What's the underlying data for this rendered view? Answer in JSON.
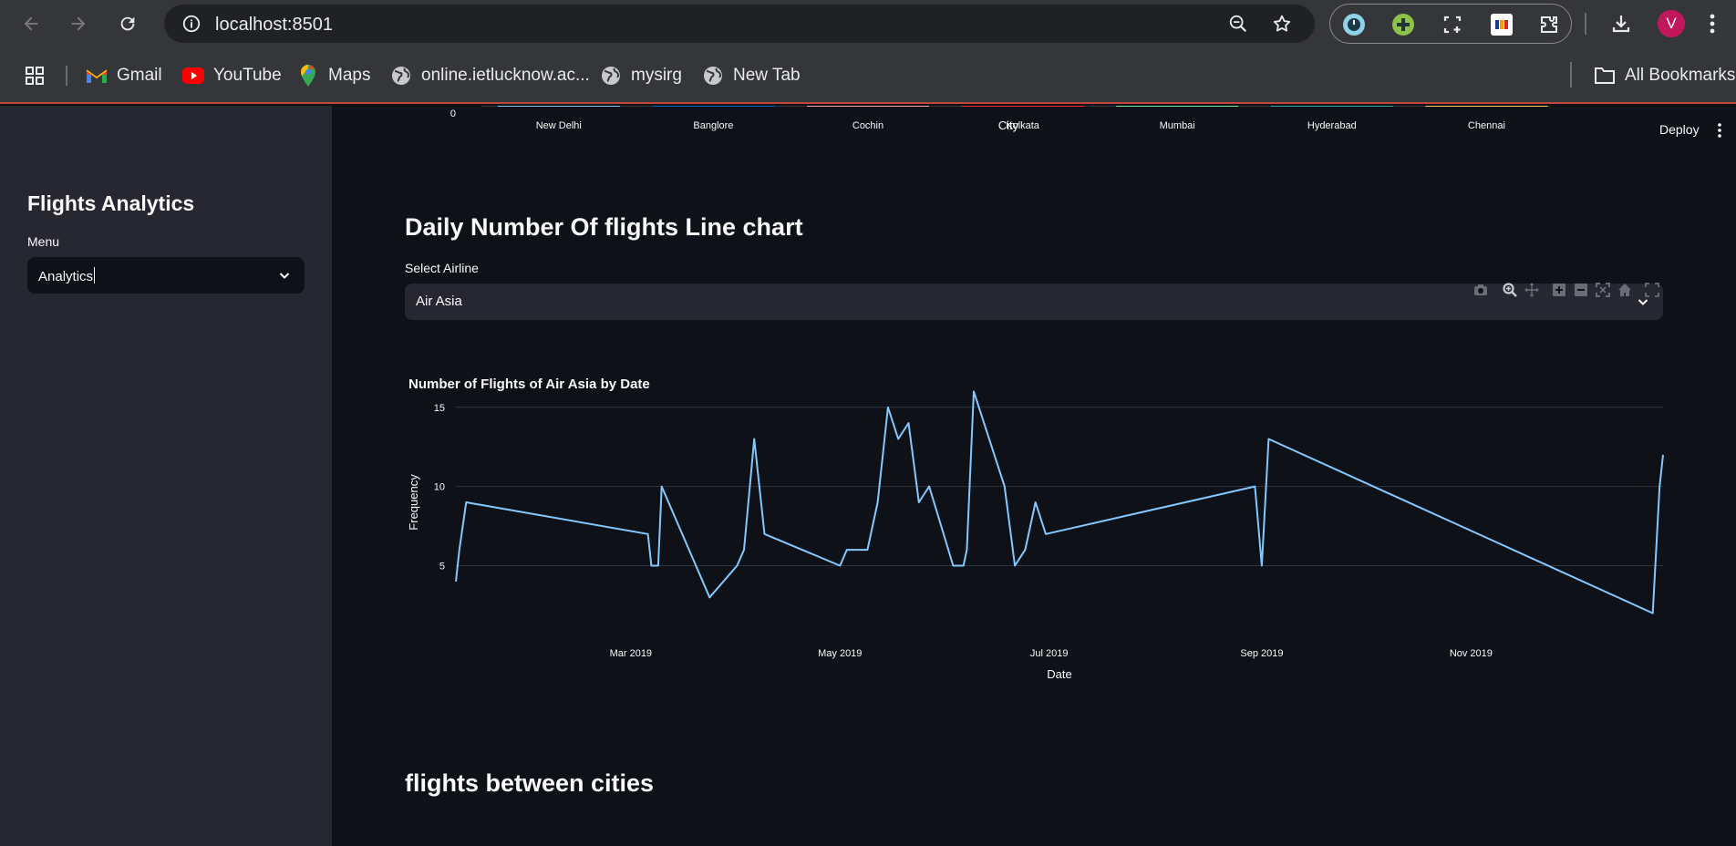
{
  "browser": {
    "url": "localhost:8501",
    "avatar_letter": "V",
    "bookmarks": [
      {
        "label": "Gmail",
        "icon": "gmail-icon"
      },
      {
        "label": "YouTube",
        "icon": "youtube-icon"
      },
      {
        "label": "Maps",
        "icon": "maps-icon"
      },
      {
        "label": "online.ietlucknow.ac...",
        "icon": "globe-icon"
      },
      {
        "label": "mysirg",
        "icon": "globe-icon"
      },
      {
        "label": "New Tab",
        "icon": "globe-icon"
      }
    ],
    "all_bookmarks_label": "All Bookmarks"
  },
  "app": {
    "deploy_label": "Deploy",
    "sidebar": {
      "title": "Flights Analytics",
      "menu_label": "Menu",
      "menu_value": "Analytics"
    },
    "sections": {
      "line_chart_heading": "Daily Number Of flights Line chart",
      "select_airline_label": "Select Airline",
      "select_airline_value": "Air Asia",
      "next_heading": "flights between cities"
    }
  },
  "chart_data": [
    {
      "type": "bar",
      "note_visible": "partially visible bar chart bottom",
      "categories": [
        "New Delhi",
        "Banglore",
        "Cochin",
        "Kolkata",
        "Mumbai",
        "Hyderabad",
        "Chennai"
      ],
      "colors": [
        "#83c9ff",
        "#0068c9",
        "#ffabab",
        "#ff2b2b",
        "#7defa1",
        "#29b09d",
        "#ffd16a"
      ],
      "xlabel": "City",
      "y_tick_visible": "0"
    },
    {
      "type": "line",
      "title": "Number of Flights  of Air Asia by Date",
      "xlabel": "Date",
      "ylabel": "Frequency",
      "color": "#83c9ff",
      "xlim": [
        "2019-01-09",
        "2019-12-27"
      ],
      "ylim": [
        1,
        17
      ],
      "y_ticks": [
        5,
        10,
        15
      ],
      "x_ticks": [
        {
          "date": "2019-03-01",
          "label": "Mar 2019"
        },
        {
          "date": "2019-05-01",
          "label": "May 2019"
        },
        {
          "date": "2019-07-01",
          "label": "Jul 2019"
        },
        {
          "date": "2019-09-01",
          "label": "Sep 2019"
        },
        {
          "date": "2019-11-01",
          "label": "Nov 2019"
        }
      ],
      "points": [
        {
          "x": "2019-01-09",
          "y": 4
        },
        {
          "x": "2019-01-10",
          "y": 6
        },
        {
          "x": "2019-01-12",
          "y": 9
        },
        {
          "x": "2019-03-06",
          "y": 7
        },
        {
          "x": "2019-03-07",
          "y": 5
        },
        {
          "x": "2019-03-09",
          "y": 5
        },
        {
          "x": "2019-03-10",
          "y": 10
        },
        {
          "x": "2019-03-24",
          "y": 3
        },
        {
          "x": "2019-04-01",
          "y": 5
        },
        {
          "x": "2019-04-03",
          "y": 6
        },
        {
          "x": "2019-04-06",
          "y": 13
        },
        {
          "x": "2019-04-09",
          "y": 7
        },
        {
          "x": "2019-05-01",
          "y": 5
        },
        {
          "x": "2019-05-03",
          "y": 6
        },
        {
          "x": "2019-05-09",
          "y": 6
        },
        {
          "x": "2019-05-12",
          "y": 9
        },
        {
          "x": "2019-05-15",
          "y": 15
        },
        {
          "x": "2019-05-18",
          "y": 13
        },
        {
          "x": "2019-05-21",
          "y": 14
        },
        {
          "x": "2019-05-24",
          "y": 9
        },
        {
          "x": "2019-05-27",
          "y": 10
        },
        {
          "x": "2019-06-03",
          "y": 5
        },
        {
          "x": "2019-06-06",
          "y": 5
        },
        {
          "x": "2019-06-07",
          "y": 6
        },
        {
          "x": "2019-06-09",
          "y": 16
        },
        {
          "x": "2019-06-18",
          "y": 10
        },
        {
          "x": "2019-06-21",
          "y": 5
        },
        {
          "x": "2019-06-24",
          "y": 6
        },
        {
          "x": "2019-06-27",
          "y": 9
        },
        {
          "x": "2019-06-30",
          "y": 7
        },
        {
          "x": "2019-08-30",
          "y": 10
        },
        {
          "x": "2019-09-01",
          "y": 5
        },
        {
          "x": "2019-09-03",
          "y": 13
        },
        {
          "x": "2019-12-24",
          "y": 2
        },
        {
          "x": "2019-12-26",
          "y": 10
        },
        {
          "x": "2019-12-27",
          "y": 12
        }
      ]
    }
  ]
}
